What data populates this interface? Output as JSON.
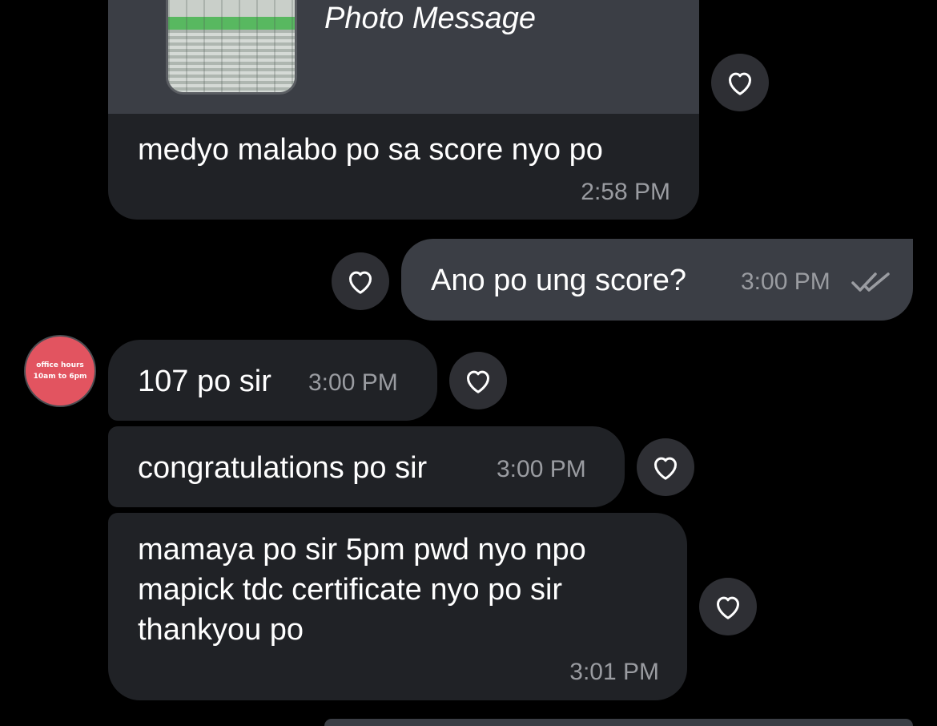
{
  "colors": {
    "background": "#000000",
    "incoming_bubble": "#202226",
    "outgoing_bubble": "#3b3e45",
    "heart_button": "#2e2f34",
    "timestamp": "#9a9ca1",
    "avatar": "#e25460"
  },
  "avatar": {
    "line1": "office hours",
    "line2": "10am to 6pm"
  },
  "messages": [
    {
      "kind": "incoming-photo",
      "label": "Photo Message",
      "text": "medyo malabo po sa score nyo po",
      "time": "2:58 PM",
      "action_icon": "heart-outline-icon"
    },
    {
      "kind": "outgoing",
      "text": "Ano po ung score?",
      "time": "3:00 PM",
      "status_icon": "double-check-icon",
      "action_icon": "heart-outline-icon"
    },
    {
      "kind": "incoming",
      "text": "107 po sir",
      "time": "3:00 PM",
      "action_icon": "heart-outline-icon"
    },
    {
      "kind": "incoming",
      "text": "congratulations po sir",
      "time": "3:00 PM",
      "action_icon": "heart-outline-icon"
    },
    {
      "kind": "incoming",
      "lines": [
        "mamaya po sir 5pm pwd nyo npo",
        "mapick tdc certificate nyo po sir",
        "thankyou po"
      ],
      "time": "3:01 PM",
      "action_icon": "heart-outline-icon"
    }
  ]
}
